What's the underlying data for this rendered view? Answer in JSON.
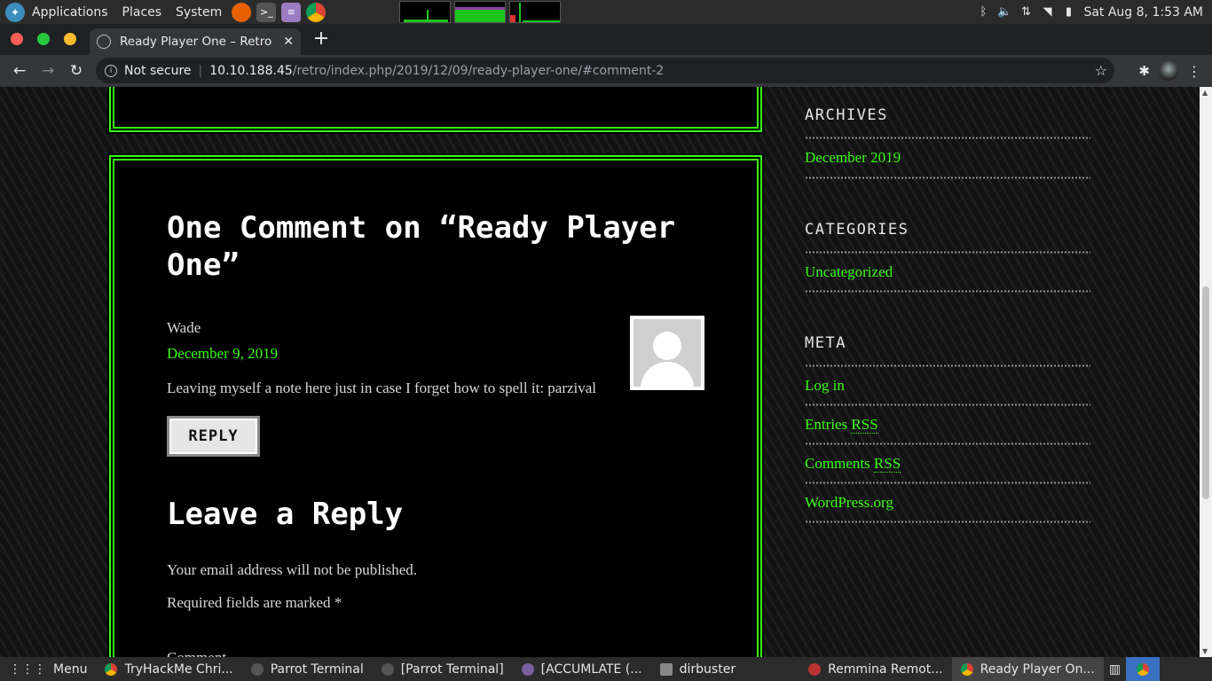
{
  "system_panel": {
    "menus": [
      "Applications",
      "Places",
      "System"
    ],
    "clock": "Sat Aug 8,  1:53 AM"
  },
  "browser": {
    "tab_title": "Ready Player One – Retro",
    "close_glyph": "✕",
    "new_tab_glyph": "+",
    "not_secure": "Not secure",
    "url_host": "10.10.188.45",
    "url_path": "/retro/index.php/2019/12/09/ready-player-one/#comment-2",
    "colors": {
      "accent_green": "#39ff14",
      "tab_bar": "#202124",
      "toolbar": "#35363a"
    }
  },
  "comments": {
    "title": "One Comment on “Ready Player One”",
    "author": "Wade",
    "date": "December 9, 2019",
    "text": "Leaving myself a note here just in case I forget how to spell it: parzival",
    "reply_label": "REPLY"
  },
  "reply_form": {
    "title": "Leave a Reply",
    "note": "Your email address will not be published.",
    "required_text": "Required fields are marked",
    "required_mark": "*",
    "comment_label": "Comment"
  },
  "sidebar": {
    "archives": {
      "title": "ARCHIVES",
      "items": [
        "December 2019"
      ]
    },
    "categories": {
      "title": "CATEGORIES",
      "items": [
        "Uncategorized"
      ]
    },
    "meta": {
      "title": "META",
      "login": "Log in",
      "entries_prefix": "Entries",
      "comments_prefix": "Comments",
      "rss": "RSS",
      "wordpress": "WordPress.org"
    }
  },
  "taskbar": {
    "menu": "Menu",
    "items": [
      "TryHackMe Chri...",
      "Parrot Terminal",
      "[Parrot Terminal]",
      "[ACCUMLATE (...",
      "dirbuster",
      "Remmina Remot...",
      "Ready Player On..."
    ]
  }
}
